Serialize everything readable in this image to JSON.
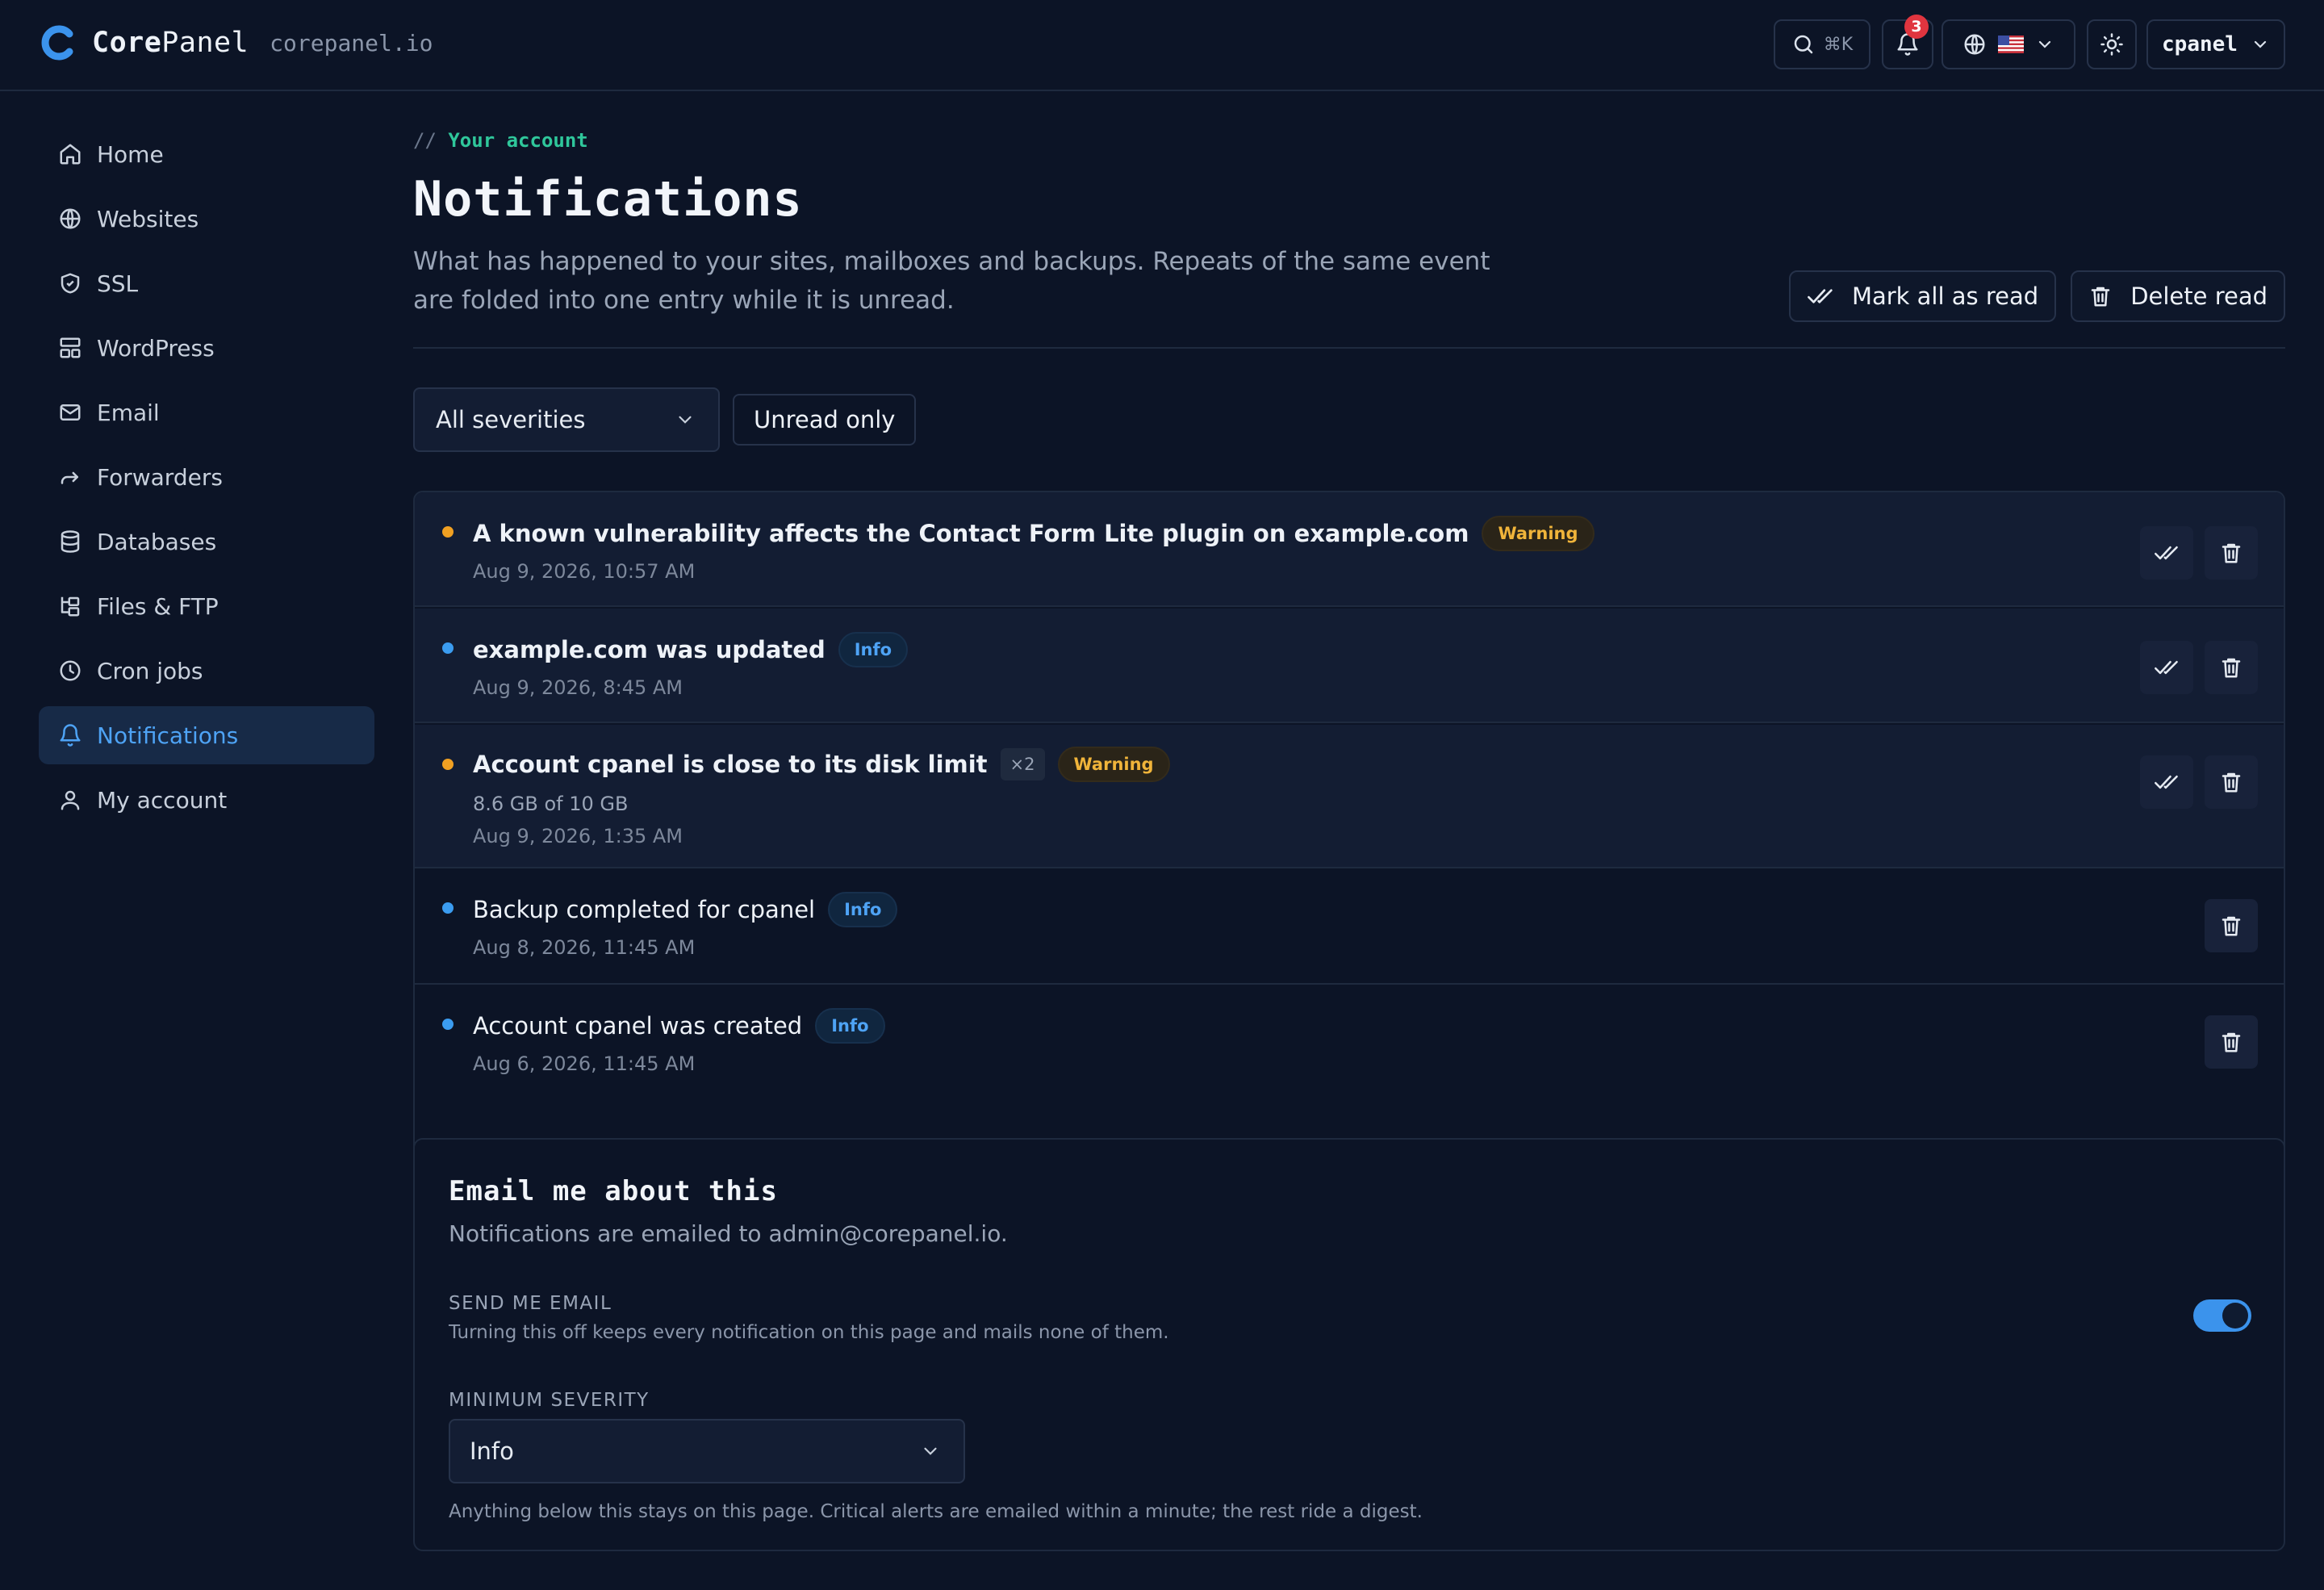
{
  "header": {
    "brand_core": "Core",
    "brand_panel": "Panel",
    "domain": "corepanel.io",
    "search_shortcut": "⌘K",
    "notification_count": "3",
    "language_flag": "us-flag-icon",
    "user": "cpanel"
  },
  "sidebar": {
    "items": [
      {
        "label": "Home",
        "icon": "home-icon"
      },
      {
        "label": "Websites",
        "icon": "globe-icon"
      },
      {
        "label": "SSL",
        "icon": "shield-icon"
      },
      {
        "label": "WordPress",
        "icon": "layout-icon"
      },
      {
        "label": "Email",
        "icon": "mail-icon"
      },
      {
        "label": "Forwarders",
        "icon": "forward-arrow-icon"
      },
      {
        "label": "Databases",
        "icon": "database-icon"
      },
      {
        "label": "Files & FTP",
        "icon": "folder-tree-icon"
      },
      {
        "label": "Cron jobs",
        "icon": "clock-icon"
      },
      {
        "label": "Notifications",
        "icon": "bell-icon",
        "active": true
      },
      {
        "label": "My account",
        "icon": "user-icon"
      }
    ]
  },
  "page": {
    "eyebrow_prefix": "//",
    "eyebrow": "Your account",
    "title": "Notifications",
    "description": "What has happened to your sites, mailboxes and backups. Repeats of the same event are folded into one entry while it is unread.",
    "mark_all_read": "Mark all as read",
    "delete_read": "Delete read"
  },
  "filters": {
    "severity": "All severities",
    "unread_only": "Unread only"
  },
  "notifications": [
    {
      "title": "A known vulnerability affects the Contact Form Lite plugin on example.com",
      "severity": "Warning",
      "date": "Aug 9, 2026, 10:57 AM",
      "unread": true
    },
    {
      "title": "example.com was updated",
      "severity": "Info",
      "date": "Aug 9, 2026, 8:45 AM",
      "unread": true
    },
    {
      "title": "Account cpanel is close to its disk limit",
      "count": "×2",
      "severity": "Warning",
      "detail": "8.6 GB of 10 GB",
      "date": "Aug 9, 2026, 1:35 AM",
      "unread": true
    },
    {
      "title": "Backup completed for cpanel",
      "severity": "Info",
      "date": "Aug 8, 2026, 11:45 AM",
      "unread": false
    },
    {
      "title": "Account cpanel was created",
      "severity": "Info",
      "date": "Aug 6, 2026, 11:45 AM",
      "unread": false
    }
  ],
  "email": {
    "title": "Email me about this",
    "subtitle": "Notifications are emailed to admin@corepanel.io.",
    "send_label": "SEND ME EMAIL",
    "send_hint": "Turning this off keeps every notification on this page and mails none of them.",
    "send_enabled": true,
    "min_label": "MINIMUM SEVERITY",
    "min_value": "Info",
    "min_hint": "Anything below this stays on this page. Critical alerts are emailed within a minute; the rest ride a digest."
  },
  "colors": {
    "warning": "#f0a022",
    "info": "#3b9cf0",
    "accent": "#4ea3f5"
  }
}
